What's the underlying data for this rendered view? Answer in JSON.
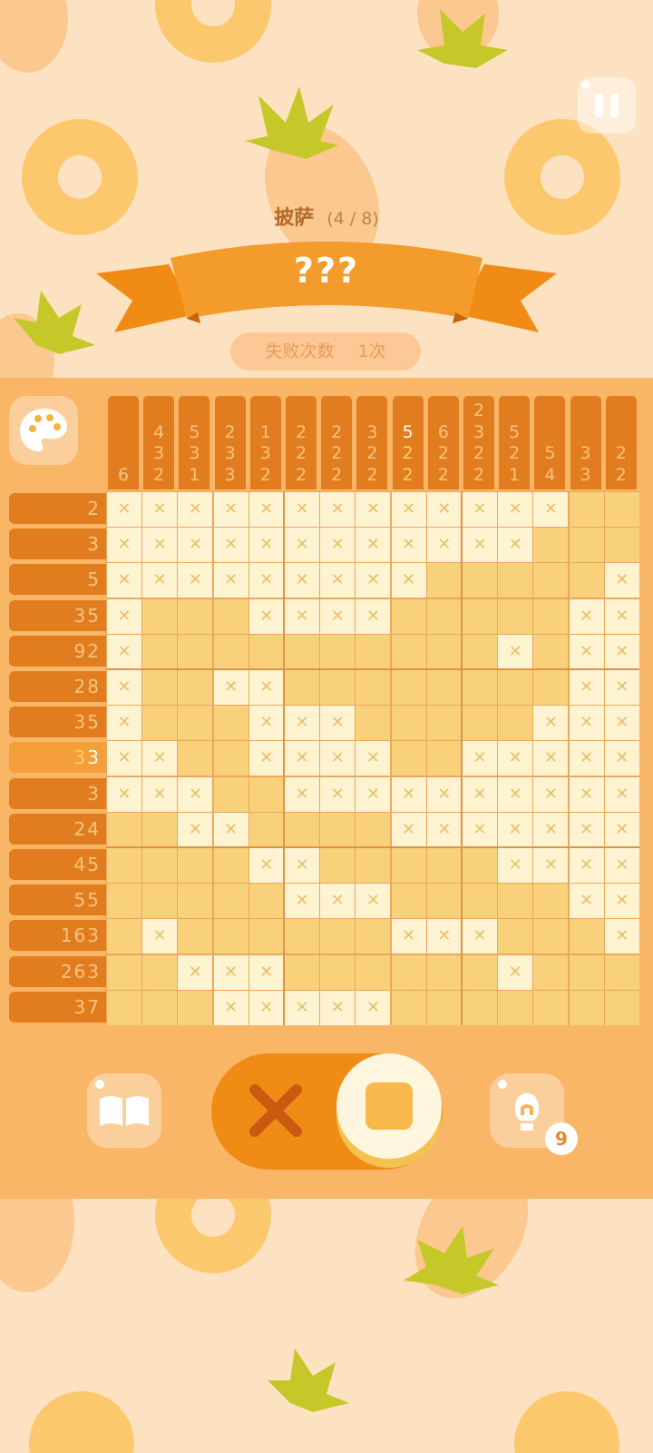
{
  "header": {
    "level_name": "披萨",
    "progress": "(4 / 8)",
    "puzzle_title": "???",
    "fail_label": "失败次数",
    "fail_count": "1次"
  },
  "column_clues": [
    [
      "6"
    ],
    [
      "4",
      "3",
      "2"
    ],
    [
      "5",
      "3",
      "1"
    ],
    [
      "2",
      "3",
      "3"
    ],
    [
      "1",
      "3",
      "2"
    ],
    [
      "2",
      "2",
      "2"
    ],
    [
      "2",
      "2",
      "2"
    ],
    [
      "3",
      "2",
      "2"
    ],
    [
      "5",
      "2",
      "2"
    ],
    [
      "6",
      "2",
      "2"
    ],
    [
      "2",
      "3",
      "2",
      "2"
    ],
    [
      "5",
      "2",
      "1"
    ],
    [
      "5",
      "4"
    ],
    [
      "3",
      "3"
    ],
    [
      "2",
      "2"
    ]
  ],
  "highlighted_column": 8,
  "row_clues": [
    "2",
    "3",
    "5",
    "35",
    "92",
    "28",
    "35",
    "33",
    "3",
    "24",
    "45",
    "55",
    "163",
    "263",
    "37"
  ],
  "highlighted_row": 7,
  "grid": [
    "XXXXXXXXXXXXX..",
    "XXXXXXXXXXXX...",
    "XXXXXXXXX.....X",
    "X...XXXX.....XX",
    "X..........X.XX",
    "X..XX........XX",
    "X...XXX.....XXX",
    "XX..XXXX..XXXXX",
    "XXX..XXXXXXXXXX",
    "..XX....XXXXXXX",
    "....XX.....XXXX",
    ".....XXX.....XX",
    ".X......XXX...X",
    "..XXX......X...",
    "...XXXXX......."
  ],
  "tools": {
    "hint_count": "9",
    "mode": "fill"
  },
  "colors": {
    "accent": "#e17d1f",
    "cell_empty": "#f8d17a",
    "cell_crossed": "#fff4d2",
    "background": "#fde2c2"
  }
}
